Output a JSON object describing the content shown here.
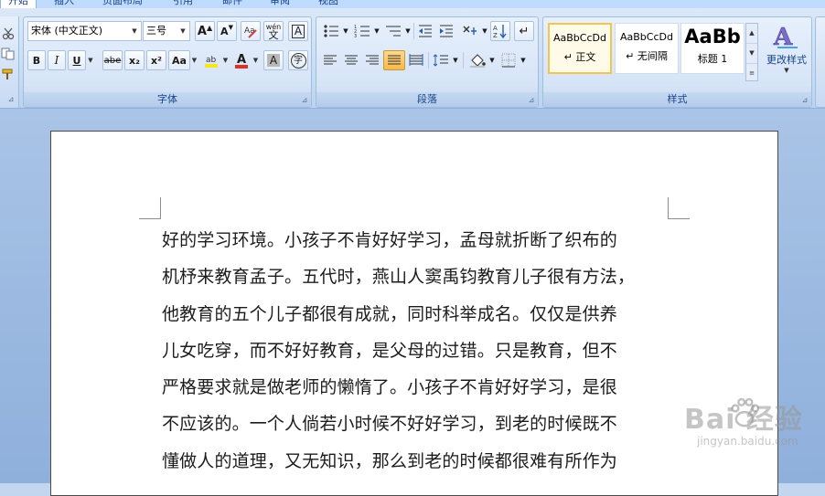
{
  "tabs": [
    "开始",
    "插入",
    "页面布局",
    "引用",
    "邮件",
    "审阅",
    "视图"
  ],
  "font_group": {
    "label": "字体",
    "font_name": "宋体 (中文正文)",
    "font_size": "三号",
    "grow_label": "A",
    "shrink_label": "A",
    "pinyin_label": "wén",
    "bold": "B",
    "italic": "I",
    "underline": "U",
    "strike": "abe",
    "subscript": "x₂",
    "superscript": "x²",
    "case": "Aa",
    "font_color": "A",
    "char_shading": "A",
    "enclose": "字"
  },
  "paragraph_group": {
    "label": "段落"
  },
  "styles_group": {
    "label": "样式",
    "styles": [
      {
        "sample": "AaBbCcDd",
        "name": "↵ 正文",
        "selected": true
      },
      {
        "sample": "AaBbCcDd",
        "name": "↵ 无间隔",
        "selected": false
      },
      {
        "sample": "AaBb",
        "name": "标题 1",
        "selected": false
      }
    ],
    "change_styles": "更改样式"
  },
  "document": {
    "lines": [
      "好的学习环境。小孩子不肯好好学习，孟母就折断了织布的",
      "机杼来教育孟子。五代时，燕山人窦禹钧教育儿子很有方法，",
      "他教育的五个儿子都很有成就，同时科举成名。仅仅是供养",
      "儿女吃穿，而不好好教育，是父母的过错。只是教育，但不",
      "严格要求就是做老师的懒惰了。小孩子不肯好好学习，是很",
      "不应该的。一个人倘若小时候不好好学习，到老的时候既不",
      "懂做人的道理，又无知识，那么到老的时候都很难有所作为"
    ]
  },
  "watermark": {
    "brand": "Bai 经验",
    "url": "jingyan.baidu.com"
  },
  "colors": {
    "highlight": "#f5e71c",
    "font_color": "#e03020",
    "accent": "#15428b"
  }
}
